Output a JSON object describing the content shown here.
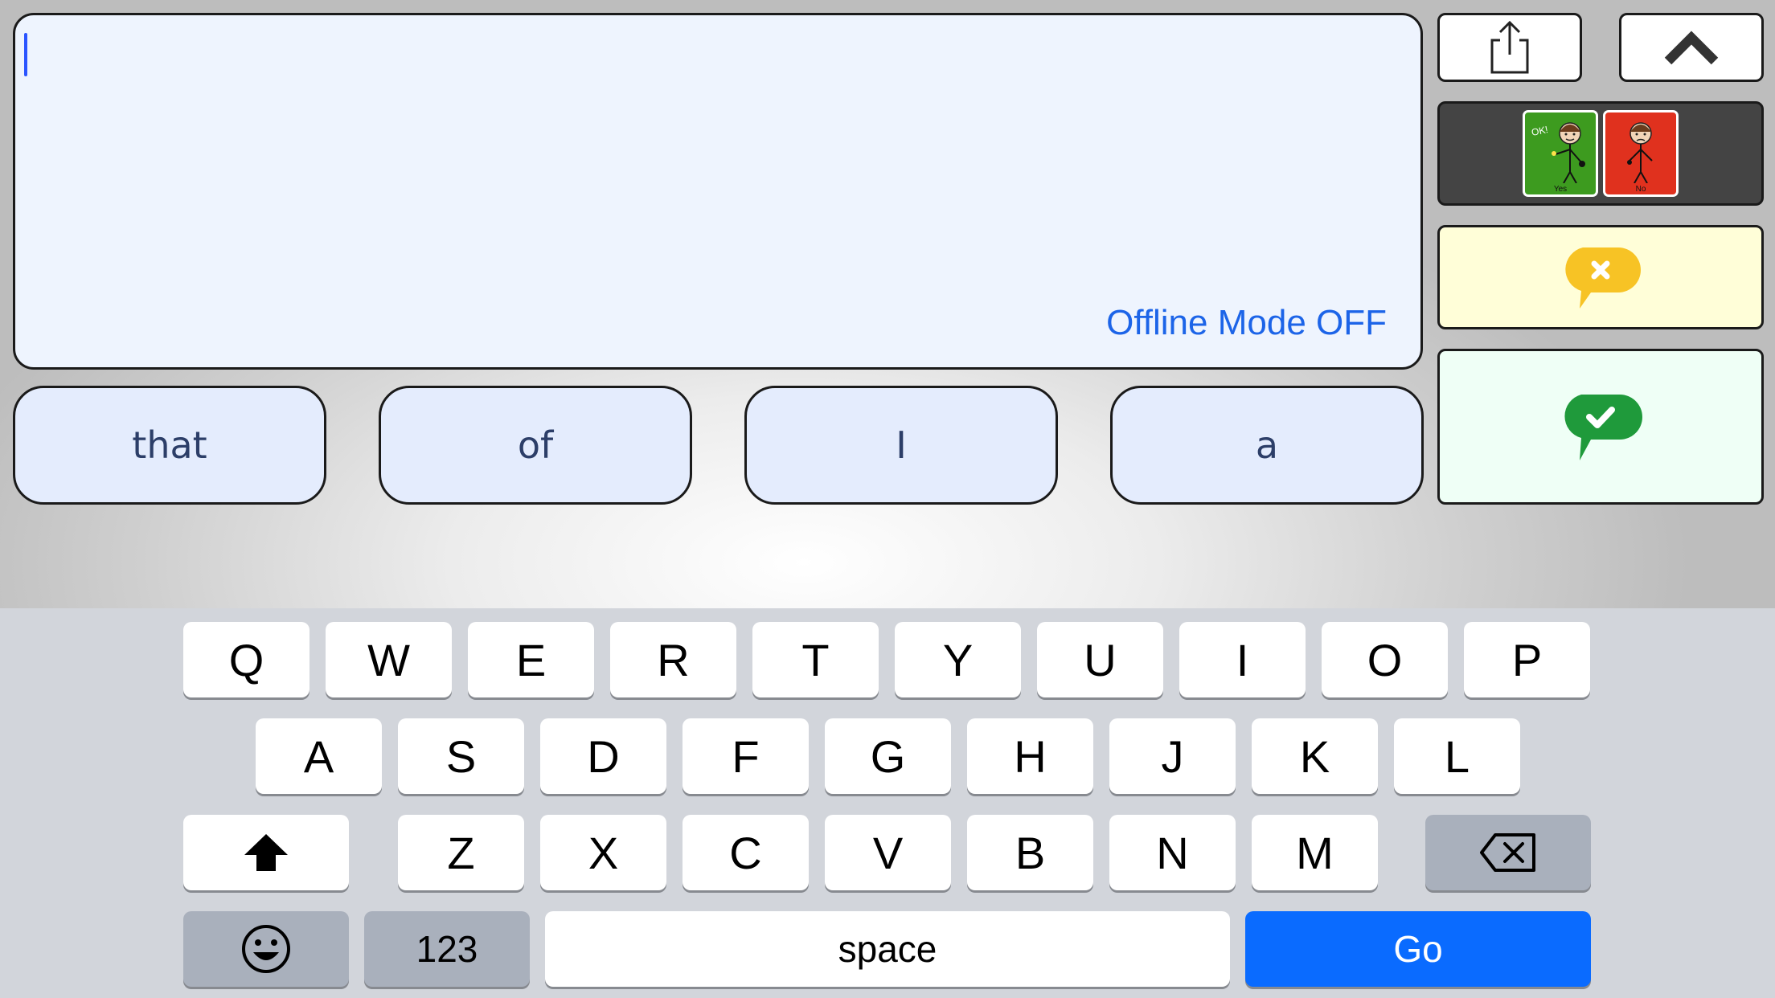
{
  "text_area": {
    "value": "",
    "status": "Offline Mode OFF"
  },
  "predictions": [
    "that",
    "of",
    "I",
    "a"
  ],
  "side_panel": {
    "share_icon": "share-icon",
    "collapse_icon": "chevron-up-icon",
    "yes_card": {
      "label": "Yes",
      "speech": "OK!",
      "color": "#3d9b1f"
    },
    "no_card": {
      "label": "No",
      "color": "#e0311e"
    },
    "clear_icon": "clear-speech-bubble-icon",
    "speak_icon": "check-speech-bubble-icon"
  },
  "keyboard": {
    "row1": [
      "Q",
      "W",
      "E",
      "R",
      "T",
      "Y",
      "U",
      "I",
      "O",
      "P"
    ],
    "row2": [
      "A",
      "S",
      "D",
      "F",
      "G",
      "H",
      "J",
      "K",
      "L"
    ],
    "row3": [
      "Z",
      "X",
      "C",
      "V",
      "B",
      "N",
      "M"
    ],
    "shift_icon": "shift-icon",
    "backspace_icon": "backspace-icon",
    "emoji_icon": "emoji-icon",
    "num_label": "123",
    "space_label": "space",
    "go_label": "Go"
  }
}
